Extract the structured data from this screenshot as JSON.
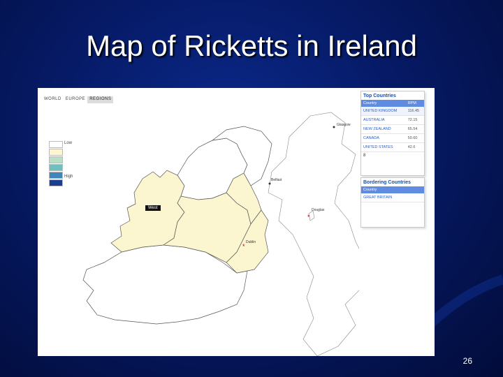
{
  "slide": {
    "title": "Map of Ricketts in Ireland",
    "number": "26"
  },
  "map_ui": {
    "tabs": [
      {
        "label": "WORLD"
      },
      {
        "label": "EUROPE"
      },
      {
        "label": "REGIONS",
        "active": true
      }
    ],
    "legend": {
      "low_label": "Low",
      "high_label": "High",
      "colors": [
        "#ffffff",
        "#fbf6cf",
        "#b9e0c4",
        "#6fbfbf",
        "#3f86b8",
        "#1b3f8f"
      ]
    },
    "tooltip": "West",
    "cities": [
      {
        "name": "Glasgow"
      },
      {
        "name": "Belfast"
      },
      {
        "name": "Douglas"
      },
      {
        "name": "Dublin"
      }
    ],
    "top_countries": {
      "title": "Top Countries",
      "col_country": "Country",
      "col_rpm": "RPM",
      "rows": [
        {
          "country": "UNITED KINGDOM",
          "rpm": "116.45"
        },
        {
          "country": "AUSTRALIA",
          "rpm": "72.15"
        },
        {
          "country": "NEW ZEALAND",
          "rpm": "65.54"
        },
        {
          "country": "CANADA",
          "rpm": "50.60"
        },
        {
          "country": "UNITED STATES",
          "rpm": "42.6"
        }
      ],
      "footer": "8"
    },
    "bordering": {
      "title": "Bordering Countries",
      "col_country": "Country",
      "rows": [
        {
          "country": "GREAT BRITAIN"
        }
      ]
    },
    "region_fill": "#fbf6cf",
    "other_fill": "#ffffff"
  }
}
